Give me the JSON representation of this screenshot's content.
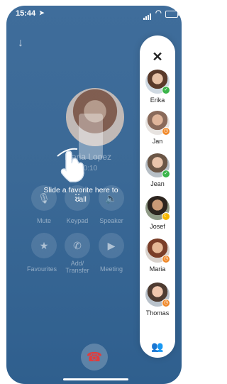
{
  "status": {
    "time": "15:44",
    "location_icon": "location-arrow-icon",
    "signal": "signal-bars-icon",
    "wifi": "wifi-icon",
    "battery": "battery-icon"
  },
  "call": {
    "contact_name": "Maria Lopez",
    "duration": "00:10",
    "minimize_icon": "arrow-down-icon",
    "hint": "Slide a favorite here to call",
    "controls_row1": [
      {
        "label": "Mute",
        "icon": "microphone-icon"
      },
      {
        "label": "Keypad",
        "icon": "keypad-icon"
      },
      {
        "label": "Speaker",
        "icon": "speaker-icon"
      }
    ],
    "controls_row2": [
      {
        "label": "Favourites",
        "icon": "star-icon"
      },
      {
        "label": "Add/ Transfer",
        "icon": "add-call-icon"
      },
      {
        "label": "Meeting",
        "icon": "video-camera-icon"
      }
    ],
    "hangup_icon": "hang-up-icon",
    "hangup_color": "#e23c3c"
  },
  "favorites": {
    "close_icon": "close-icon",
    "contacts": [
      {
        "name": "Erika",
        "status": "available",
        "status_color": "#3bb54a"
      },
      {
        "name": "Jan",
        "status": "away",
        "status_color": "#f08a2c"
      },
      {
        "name": "Jean",
        "status": "available",
        "status_color": "#3bb54a"
      },
      {
        "name": "Josef",
        "status": "busy",
        "status_color": "#f5b800"
      },
      {
        "name": "Maria",
        "status": "away",
        "status_color": "#f08a2c"
      },
      {
        "name": "Thomas",
        "status": "away",
        "status_color": "#f08a2c"
      }
    ],
    "group_icon": "group-icon",
    "accent": "#3b8fe0"
  }
}
